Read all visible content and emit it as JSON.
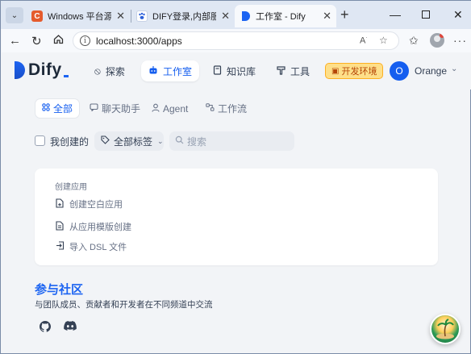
{
  "browser": {
    "tabs": [
      {
        "title": "Windows 平台源码",
        "favicon": "C",
        "favicon_color": "#e55b2d",
        "active": false
      },
      {
        "title": "DIFY登录,内部服务",
        "favicon": "paw",
        "favicon_color": "#2b5fd9",
        "active": false
      },
      {
        "title": "工作室 - Dify",
        "favicon": "dify",
        "favicon_color": "#1c64f2",
        "active": true
      }
    ],
    "url": "localhost:3000/apps"
  },
  "header": {
    "brand": "Dify",
    "nav": [
      {
        "label": "探索",
        "icon": "compass-icon",
        "active": false
      },
      {
        "label": "工作室",
        "icon": "robot-icon",
        "active": true
      },
      {
        "label": "知识库",
        "icon": "book-icon",
        "active": false
      },
      {
        "label": "工具",
        "icon": "hammer-icon",
        "active": false
      }
    ],
    "env_badge": "开发环境",
    "avatar_initial": "O",
    "user_name": "Orange"
  },
  "filters": {
    "tabs": [
      {
        "label": "全部",
        "icon": "grid-icon",
        "active": true
      },
      {
        "label": "聊天助手",
        "icon": "chat-icon",
        "active": false
      },
      {
        "label": "Agent",
        "icon": "agent-icon",
        "active": false
      },
      {
        "label": "工作流",
        "icon": "workflow-icon",
        "active": false
      }
    ],
    "mine_label": "我创建的",
    "tag_select": "全部标签",
    "search_placeholder": "搜索"
  },
  "create_card": {
    "title": "创建应用",
    "options": [
      "创建空白应用",
      "从应用模版创建",
      "导入 DSL 文件"
    ]
  },
  "community": {
    "title": "参与社区",
    "description": "与团队成员、贡献者和开发者在不同频道中交流"
  },
  "colors": {
    "accent": "#155eef",
    "brand": "#1c64f2",
    "badge_bg": "#fedf89",
    "badge_text": "#b54708"
  }
}
